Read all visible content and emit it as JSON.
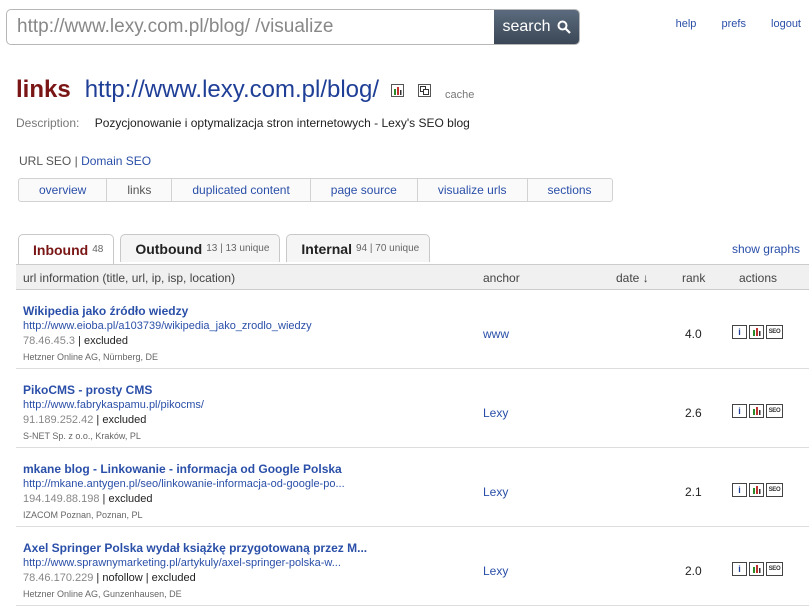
{
  "search": {
    "value": "http://www.lexy.com.pl/blog/ /visualize",
    "button_label": "search"
  },
  "top_links": {
    "help": "help",
    "prefs": "prefs",
    "logout": "logout"
  },
  "header": {
    "title": "links",
    "url": "http://www.lexy.com.pl/blog/",
    "cache_label": "cache",
    "description_label": "Description:",
    "description": "Pozycjonowanie i optymalizacja stron internetowych - Lexy's SEO blog"
  },
  "seo_switch": {
    "url_seo": "URL SEO",
    "separator": "|",
    "domain_seo": "Domain SEO"
  },
  "nav": [
    "overview",
    "links",
    "duplicated content",
    "page source",
    "visualize urls",
    "sections"
  ],
  "tabs": [
    {
      "label": "Inbound",
      "count": "48"
    },
    {
      "label": "Outbound",
      "count": "13 | 13 unique"
    },
    {
      "label": "Internal",
      "count": "94 | 70 unique"
    }
  ],
  "show_graphs": "show graphs",
  "table": {
    "headers": {
      "info": "url information (title, url, ip, isp, location)",
      "anchor": "anchor",
      "date": "date ↓",
      "rank": "rank",
      "actions": "actions"
    },
    "rows": [
      {
        "title": "Wikipedia jako źródło wiedzy",
        "url": "http://www.eioba.pl/a103739/wikipedia_jako_zrodlo_wiedzy",
        "ip": "78.46.45.3",
        "flags": "| excluded",
        "isp": "Hetzner Online AG, Nürnberg, DE",
        "anchor": "www",
        "rank": "4.0"
      },
      {
        "title": "PikoCMS - prosty CMS",
        "url": "http://www.fabrykaspamu.pl/pikocms/",
        "ip": "91.189.252.42",
        "flags": "| excluded",
        "isp": "S-NET Sp. z o.o., Kraków, PL",
        "anchor": "Lexy",
        "rank": "2.6"
      },
      {
        "title": "mkane blog - Linkowanie - informacja od Google Polska",
        "url": "http://mkane.antygen.pl/seo/linkowanie-informacja-od-google-po...",
        "ip": "194.149.88.198",
        "flags": "| excluded",
        "isp": "IZACOM Poznan, Poznan, PL",
        "anchor": "Lexy",
        "rank": "2.1"
      },
      {
        "title": "Axel Springer Polska wydał książkę przygotowaną przez M...",
        "url": "http://www.sprawnymarketing.pl/artykuly/axel-springer-polska-w...",
        "ip": "78.46.170.229",
        "flags": "| nofollow | excluded",
        "isp": "Hetzner Online AG, Gunzenhausen, DE",
        "anchor": "Lexy",
        "rank": "2.0"
      }
    ]
  },
  "action_labels": {
    "info": "i",
    "seo": "SEO"
  }
}
